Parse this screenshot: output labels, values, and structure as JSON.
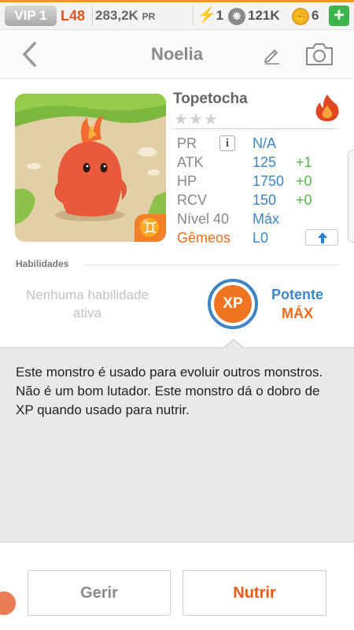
{
  "status_bar": {
    "vip": "VIP 1",
    "level": "L48",
    "power": "283,2K",
    "power_unit": "PR",
    "energy": "1",
    "food": "121K",
    "coins": "6",
    "add_label": "+",
    "accent_color": "#f39a1c"
  },
  "header": {
    "title": "Noelia",
    "icons": [
      "back-arrow-icon",
      "pencil-icon",
      "camera-icon"
    ]
  },
  "monster": {
    "species": "Topetocha",
    "stars": "★★★",
    "element_icon": "fire-icon",
    "zodiac_icon": "gemini-icon",
    "zodiac_symbol": "♊"
  },
  "stats": {
    "pr": {
      "label": "PR",
      "value": "N/A",
      "info": "i"
    },
    "atk": {
      "label": "ATK",
      "value": "125",
      "bonus": "+1"
    },
    "hp": {
      "label": "HP",
      "value": "1750",
      "bonus": "+0"
    },
    "rcv": {
      "label": "RCV",
      "value": "150",
      "bonus": "+0"
    },
    "level": {
      "label": "Nível 40",
      "value": "Máx"
    },
    "twins": {
      "label": "Gêmeos",
      "value": "L0",
      "upgrade_icon": "arrow-up-icon"
    }
  },
  "abilities": {
    "section_label": "Habilidades",
    "none_text": "Nenhuma habilidade ativa",
    "xp_badge": "XP",
    "potency_label": "Potente",
    "potency_level": "MÁX"
  },
  "description": "Este monstro é usado para evoluir outros monstros. Não é um bom lutador. Este monstro dá o dobro de XP quando usado para nutrir.",
  "actions": {
    "manage": "Gerir",
    "feed": "Nutrir"
  }
}
